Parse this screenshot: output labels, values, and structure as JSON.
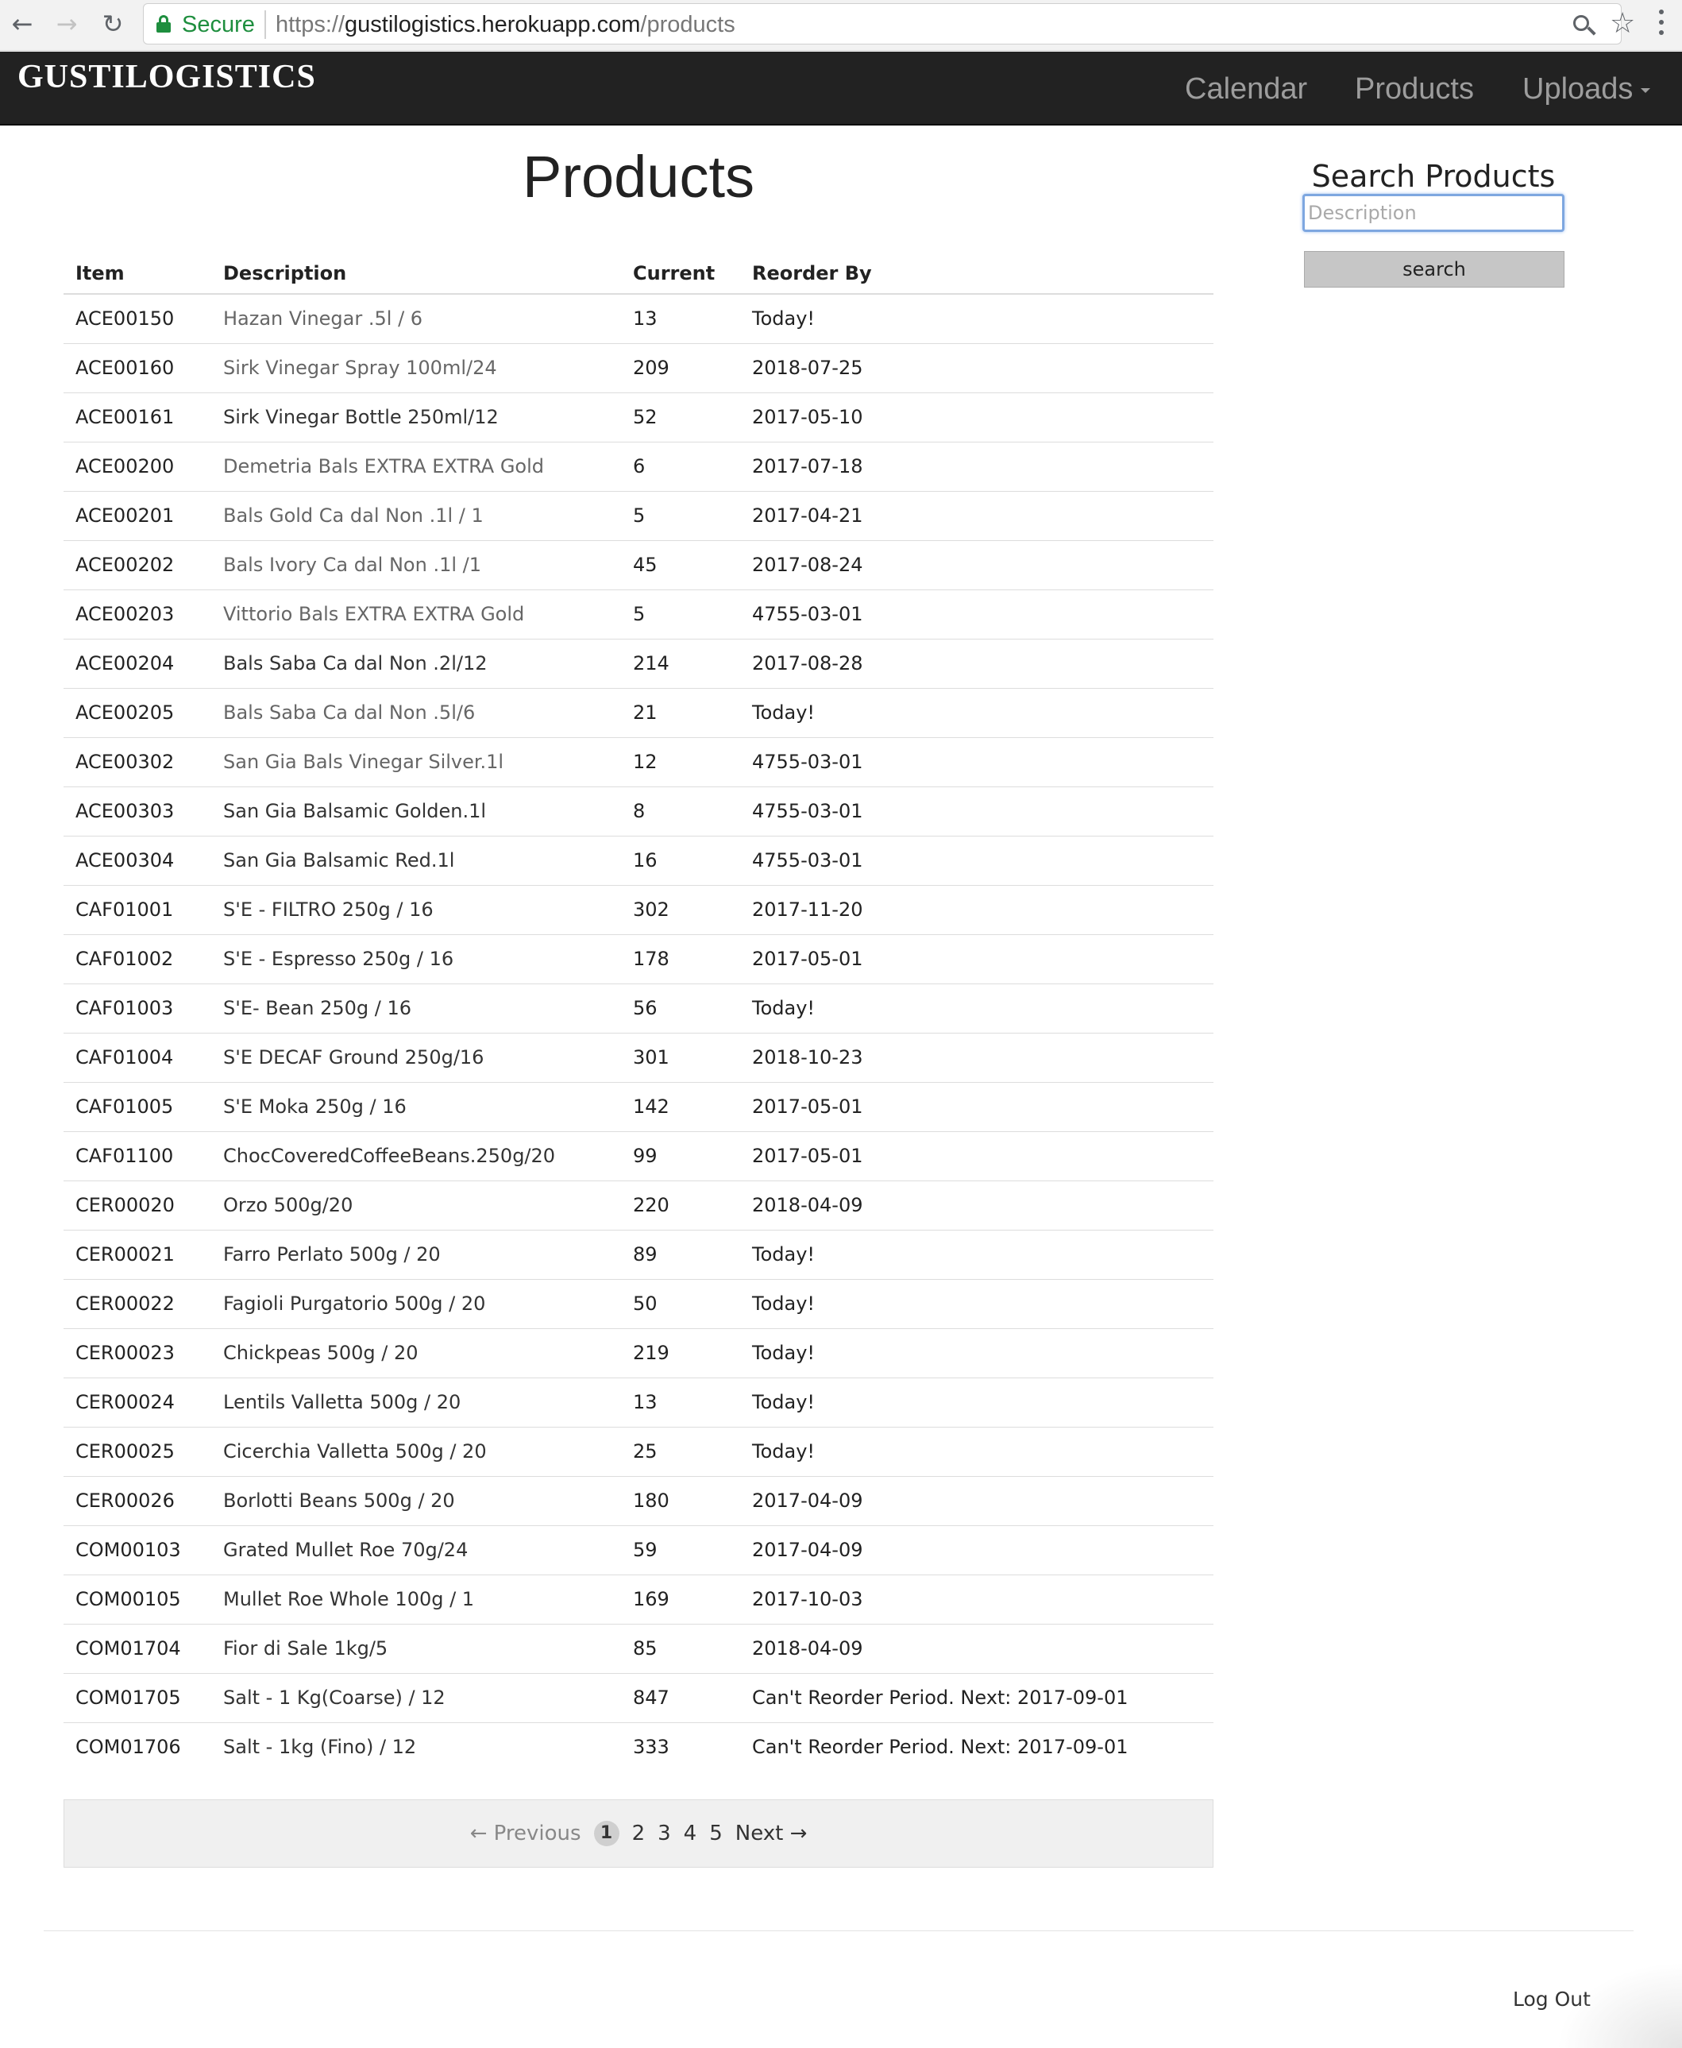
{
  "browser": {
    "secure_label": "Secure",
    "url_scheme": "https://",
    "url_host": "gustilogistics.herokuapp.com",
    "url_path": "/products"
  },
  "navbar": {
    "brand": "GUSTILOGISTICS",
    "links": [
      "Calendar",
      "Products",
      "Uploads"
    ]
  },
  "main": {
    "title": "Products",
    "table": {
      "headers": [
        "Item",
        "Description",
        "Current",
        "Reorder By"
      ],
      "rows": [
        {
          "item": "ACE00150",
          "description": "Hazan Vinegar .5l / 6",
          "current": "13",
          "reorder_by": "Today!"
        },
        {
          "item": "ACE00160",
          "description": "Sirk Vinegar Spray 100ml/24",
          "current": "209",
          "reorder_by": "2018-07-25"
        },
        {
          "item": "ACE00161",
          "description": "Sirk Vinegar Bottle 250ml/12",
          "current": "52",
          "reorder_by": "2017-05-10"
        },
        {
          "item": "ACE00200",
          "description": "Demetria Bals EXTRA EXTRA Gold",
          "current": "6",
          "reorder_by": "2017-07-18"
        },
        {
          "item": "ACE00201",
          "description": "Bals Gold Ca dal Non .1l / 1",
          "current": "5",
          "reorder_by": "2017-04-21"
        },
        {
          "item": "ACE00202",
          "description": "Bals Ivory Ca dal Non .1l /1",
          "current": "45",
          "reorder_by": "2017-08-24"
        },
        {
          "item": "ACE00203",
          "description": "Vittorio Bals EXTRA EXTRA Gold",
          "current": "5",
          "reorder_by": "4755-03-01"
        },
        {
          "item": "ACE00204",
          "description": "Bals Saba Ca dal Non .2l/12",
          "current": "214",
          "reorder_by": "2017-08-28"
        },
        {
          "item": "ACE00205",
          "description": "Bals Saba Ca dal Non .5l/6",
          "current": "21",
          "reorder_by": "Today!"
        },
        {
          "item": "ACE00302",
          "description": "San Gia Bals Vinegar Silver.1l",
          "current": "12",
          "reorder_by": "4755-03-01"
        },
        {
          "item": "ACE00303",
          "description": "San Gia Balsamic Golden.1l",
          "current": "8",
          "reorder_by": "4755-03-01"
        },
        {
          "item": "ACE00304",
          "description": "San Gia Balsamic Red.1l",
          "current": "16",
          "reorder_by": "4755-03-01"
        },
        {
          "item": "CAF01001",
          "description": "S'E - FILTRO 250g / 16",
          "current": "302",
          "reorder_by": "2017-11-20"
        },
        {
          "item": "CAF01002",
          "description": "S'E - Espresso 250g / 16",
          "current": "178",
          "reorder_by": "2017-05-01"
        },
        {
          "item": "CAF01003",
          "description": "S'E- Bean 250g / 16",
          "current": "56",
          "reorder_by": "Today!"
        },
        {
          "item": "CAF01004",
          "description": "S'E DECAF Ground 250g/16",
          "current": "301",
          "reorder_by": "2018-10-23"
        },
        {
          "item": "CAF01005",
          "description": "S'E Moka 250g / 16",
          "current": "142",
          "reorder_by": "2017-05-01"
        },
        {
          "item": "CAF01100",
          "description": "ChocCoveredCoffeeBeans.250g/20",
          "current": "99",
          "reorder_by": "2017-05-01"
        },
        {
          "item": "CER00020",
          "description": "Orzo 500g/20",
          "current": "220",
          "reorder_by": "2018-04-09"
        },
        {
          "item": "CER00021",
          "description": "Farro Perlato 500g / 20",
          "current": "89",
          "reorder_by": "Today!"
        },
        {
          "item": "CER00022",
          "description": "Fagioli Purgatorio 500g / 20",
          "current": "50",
          "reorder_by": "Today!"
        },
        {
          "item": "CER00023",
          "description": "Chickpeas 500g / 20",
          "current": "219",
          "reorder_by": "Today!"
        },
        {
          "item": "CER00024",
          "description": "Lentils Valletta 500g / 20",
          "current": "13",
          "reorder_by": "Today!"
        },
        {
          "item": "CER00025",
          "description": "Cicerchia Valletta 500g / 20",
          "current": "25",
          "reorder_by": "Today!"
        },
        {
          "item": "CER00026",
          "description": "Borlotti Beans 500g / 20",
          "current": "180",
          "reorder_by": "2017-04-09"
        },
        {
          "item": "COM00103",
          "description": "Grated Mullet Roe 70g/24",
          "current": "59",
          "reorder_by": "2017-04-09"
        },
        {
          "item": "COM00105",
          "description": "Mullet Roe Whole 100g / 1",
          "current": "169",
          "reorder_by": "2017-10-03"
        },
        {
          "item": "COM01704",
          "description": "Fior di Sale 1kg/5",
          "current": "85",
          "reorder_by": "2018-04-09"
        },
        {
          "item": "COM01705",
          "description": "Salt - 1 Kg(Coarse) / 12",
          "current": "847",
          "reorder_by": "Can't Reorder Period. Next: 2017-09-01"
        },
        {
          "item": "COM01706",
          "description": "Salt - 1kg (Fino) / 12",
          "current": "333",
          "reorder_by": "Can't Reorder Period. Next: 2017-09-01"
        }
      ]
    },
    "pagination": {
      "previous": "← Previous",
      "pages": [
        "1",
        "2",
        "3",
        "4",
        "5"
      ],
      "current": "1",
      "next": "Next →"
    }
  },
  "search": {
    "title": "Search Products",
    "placeholder": "Description",
    "button": "search"
  },
  "footer": {
    "logout": "Log Out"
  }
}
